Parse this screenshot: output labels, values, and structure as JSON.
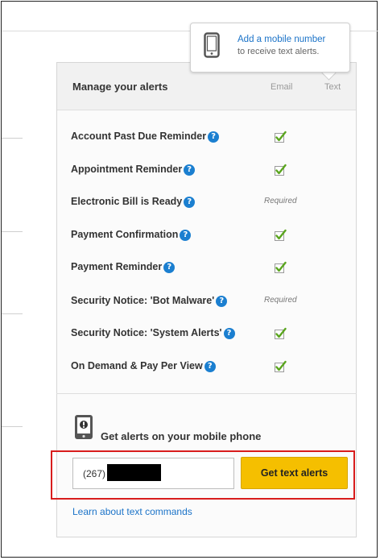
{
  "tooltip": {
    "line1": "Add a mobile number",
    "line2": "to receive text alerts."
  },
  "panel": {
    "title": "Manage your alerts",
    "col_email": "Email",
    "col_text": "Text"
  },
  "alerts": [
    {
      "label": "Account Past Due Reminder",
      "email": "checked"
    },
    {
      "label": "Appointment Reminder",
      "email": "checked"
    },
    {
      "label": "Electronic Bill is Ready",
      "email": "Required"
    },
    {
      "label": "Payment Confirmation",
      "email": "checked"
    },
    {
      "label": "Payment Reminder",
      "email": "checked"
    },
    {
      "label": "Security Notice: 'Bot Malware'",
      "email": "Required"
    },
    {
      "label": "Security Notice: 'System Alerts'",
      "email": "checked"
    },
    {
      "label": "On Demand & Pay Per View",
      "email": "checked"
    }
  ],
  "help_glyph": "?",
  "mobile": {
    "title": "Get alerts on your mobile phone",
    "phone_value": "(267)",
    "button_label": "Get text alerts",
    "learn_link": "Learn about text commands"
  },
  "colors": {
    "accent_yellow": "#f5bf00",
    "link_blue": "#1b73c8",
    "check_green": "#5aa51e",
    "highlight_red": "#d81c1c"
  }
}
